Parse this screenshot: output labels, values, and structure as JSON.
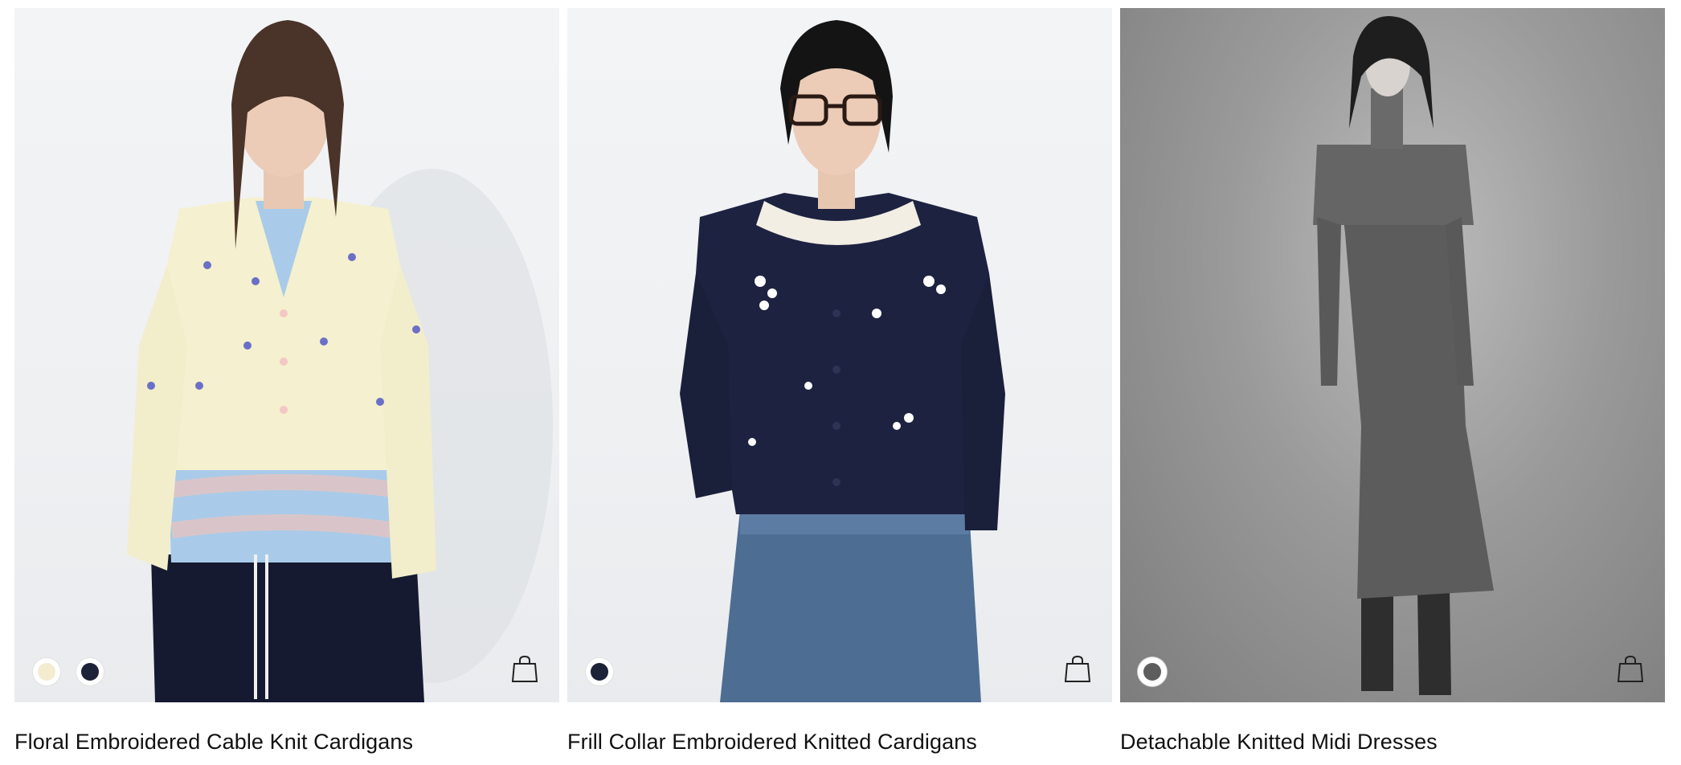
{
  "products": [
    {
      "name": "Floral Embroidered Cable Knit Cardigans",
      "swatches": [
        {
          "icon": "cream-cardigan-thumbnail",
          "color": "#f3eccf",
          "selected": false
        },
        {
          "icon": "navy-cardigan-thumbnail",
          "color": "#1c2238",
          "selected": false
        }
      ],
      "bag_icon": "shopping-bag-icon"
    },
    {
      "name": "Frill Collar Embroidered Knitted Cardigans",
      "swatches": [
        {
          "icon": "navy-cardigan-thumbnail",
          "color": "#1c2238",
          "selected": false
        }
      ],
      "bag_icon": "shopping-bag-icon"
    },
    {
      "name": "Detachable Knitted Midi Dresses",
      "swatches": [
        {
          "icon": "gray-dress-thumbnail",
          "color": "#5d5d5d",
          "selected": true
        }
      ],
      "bag_icon": "shopping-bag-icon"
    }
  ]
}
